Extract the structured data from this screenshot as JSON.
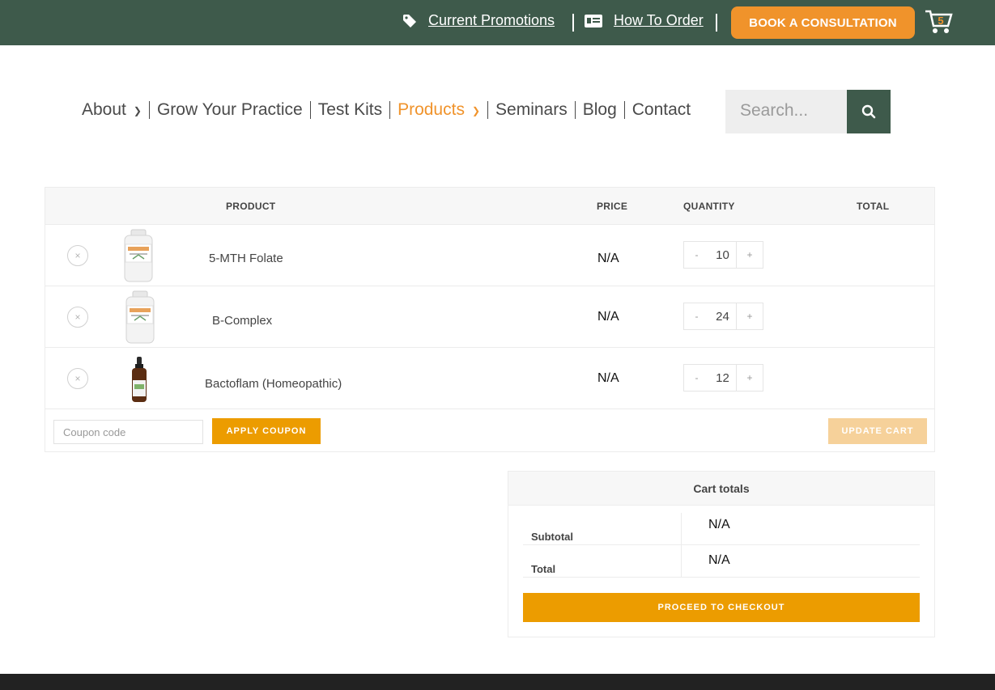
{
  "topbar": {
    "promo_label": "Current Promotions",
    "order_label": "How To Order",
    "book_label": "BOOK A CONSULTATION",
    "cart_count": "5"
  },
  "nav": {
    "items": [
      {
        "label": "About"
      },
      {
        "label": "Grow Your Practice"
      },
      {
        "label": "Test Kits"
      },
      {
        "label": "Products"
      },
      {
        "label": "Seminars"
      },
      {
        "label": "Blog"
      },
      {
        "label": "Contact"
      }
    ],
    "search_placeholder": "Search..."
  },
  "cart": {
    "headers": {
      "product": "PRODUCT",
      "price": "PRICE",
      "quantity": "QUANTITY",
      "total": "TOTAL"
    },
    "items": [
      {
        "name": "5-MTH Folate",
        "price": "N/A",
        "qty": "10"
      },
      {
        "name": "B-Complex",
        "price": "N/A",
        "qty": "24"
      },
      {
        "name": "Bactoflam (Homeopathic)",
        "price": "N/A",
        "qty": "12"
      }
    ],
    "coupon_placeholder": "Coupon code",
    "apply_label": "APPLY COUPON",
    "update_label": "UPDATE CART",
    "remove_symbol": "×",
    "minus_symbol": "-",
    "plus_symbol": "+"
  },
  "totals": {
    "title": "Cart totals",
    "subtotal_label": "Subtotal",
    "subtotal_value": "N/A",
    "total_label": "Total",
    "total_value": "N/A",
    "checkout_label": "PROCEED TO CHECKOUT"
  },
  "colors": {
    "brand_green": "#3e5a4b",
    "accent_orange": "#f0932b",
    "button_orange": "#ec9c00"
  }
}
